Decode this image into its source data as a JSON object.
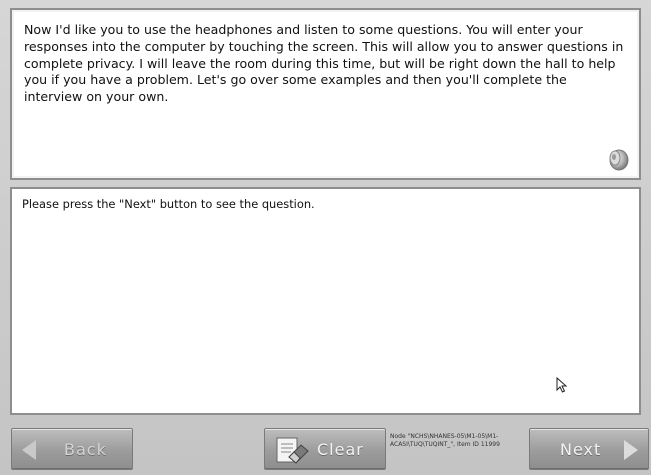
{
  "prompt_panel": {
    "text": "Now I'd like you to use the headphones and listen to some questions. You will enter your responses into the computer by touching the screen. This will allow you to answer questions in complete privacy. I will leave the room during this time, but will be right down the hall to help you if you have a problem. Let's go over some examples and then you'll complete the interview on your own.",
    "speaker_icon": "speaker-icon"
  },
  "question_panel": {
    "text": "Please press the \"Next\" button to see the question."
  },
  "buttons": {
    "back_label": "Back",
    "clear_label": "Clear",
    "next_label": "Next"
  },
  "node_info": {
    "line1": "Node \"NCHS\\NHANES-05\\M1-05\\M1-",
    "line2": "ACASI\\TUQ\\TUQINT_\", Item ID 11999"
  },
  "icons": {
    "back": "arrow-left-icon",
    "next": "arrow-right-icon",
    "clear": "eraser-icon",
    "cursor": "mouse-pointer-icon"
  }
}
